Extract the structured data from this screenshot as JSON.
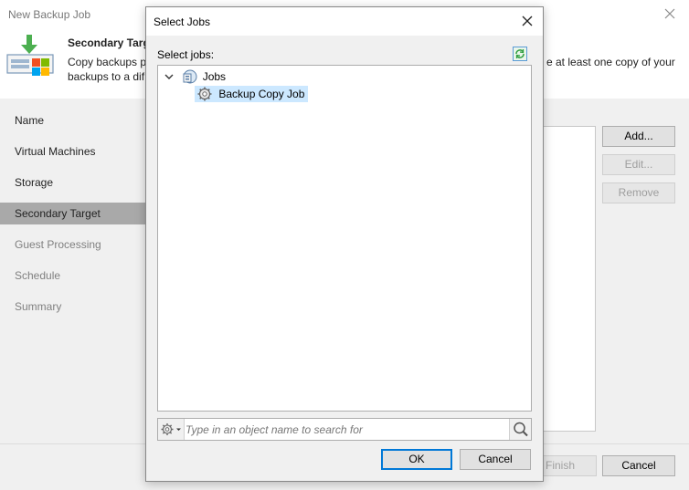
{
  "wizard": {
    "title": "New Backup Job",
    "header": {
      "title": "Secondary Target",
      "description_line1": "Copy backups p",
      "description_line2": "backups to a dif",
      "description_right": "e at least one copy of your"
    },
    "nav": [
      {
        "label": "Name",
        "state": "normal"
      },
      {
        "label": "Virtual Machines",
        "state": "normal"
      },
      {
        "label": "Storage",
        "state": "normal"
      },
      {
        "label": "Secondary Target",
        "state": "active"
      },
      {
        "label": "Guest Processing",
        "state": "disabled"
      },
      {
        "label": "Schedule",
        "state": "disabled"
      },
      {
        "label": "Summary",
        "state": "disabled"
      }
    ],
    "side_buttons": {
      "add": "Add...",
      "edit": "Edit...",
      "remove": "Remove"
    },
    "footer_buttons": {
      "finish": "Finish",
      "cancel": "Cancel"
    }
  },
  "dialog": {
    "title": "Select Jobs",
    "label": "Select jobs:",
    "tree": {
      "root": "Jobs",
      "children": [
        "Backup Copy Job"
      ]
    },
    "search": {
      "placeholder": "Type in an object name to search for",
      "value": ""
    },
    "buttons": {
      "ok": "OK",
      "cancel": "Cancel"
    }
  },
  "colors": {
    "nav_active": "#a9a9a9",
    "selection": "#cce8ff",
    "default_button_border": "#0078d7",
    "refresh_icon": "#2e9e3e"
  }
}
